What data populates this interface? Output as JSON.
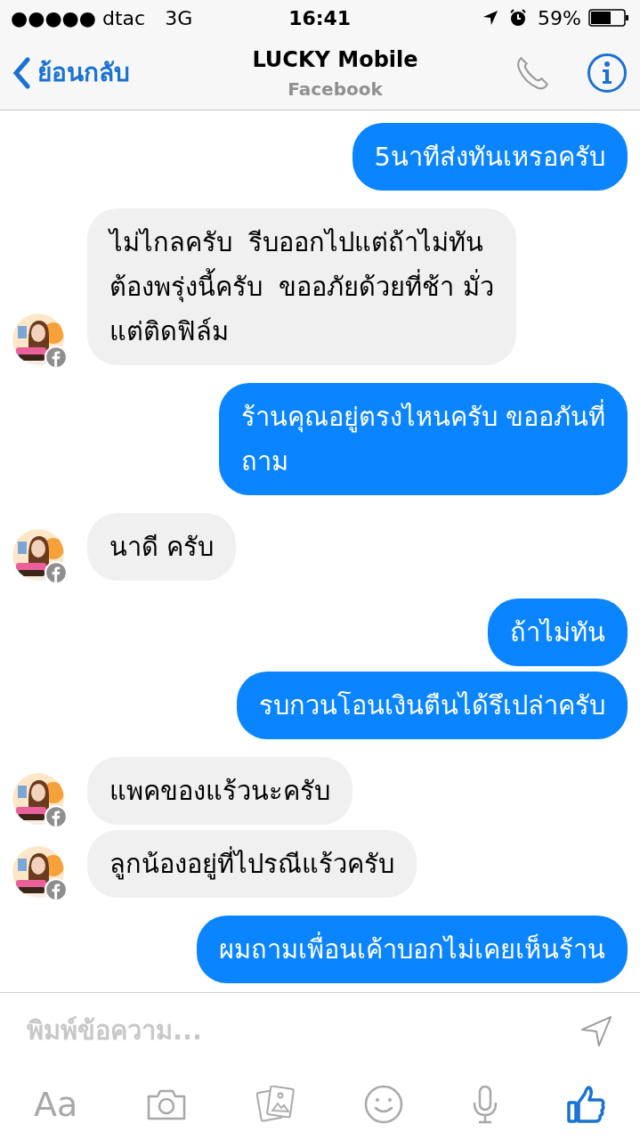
{
  "status_bar": {
    "carrier": "●●●●● dtac",
    "network": "3G",
    "time": "16:41",
    "battery": "59%"
  },
  "header": {
    "back": "ย้อนกลับ",
    "title": "LUCKY Mobile",
    "subtitle": "Facebook"
  },
  "messages": [
    {
      "kind": "sent",
      "text": "5นาทีส่งทันเหรอครับ"
    },
    {
      "kind": "received",
      "text": "ไม่ไกลครับ  รีบออกไปแต่ถ้าไม่ทัน\nต้องพรุ่งนี้ครับ  ขออภัยด้วยที่ช้า มั่ว\nแต่ติดฟิล์ม"
    },
    {
      "kind": "sent",
      "text": "ร้านคุณอยู่ตรงไหนครับ ขออภันที่\nถาม"
    },
    {
      "kind": "received",
      "text": "นาดี ครับ"
    },
    {
      "kind": "sent",
      "text": "ถ้าไม่ทัน"
    },
    {
      "kind": "sent",
      "text": "รบกวนโอนเงินตืนได้รึเปล่าครับ"
    },
    {
      "kind": "received",
      "text": "แพคของแร้วนะครับ"
    },
    {
      "kind": "received",
      "text": "ลูกน้องอยู่ที่ไปรณีแร้วครับ"
    },
    {
      "kind": "sent",
      "text": "ผมถามเพื่อนเค้าบอกไม่เคยเห็นร้าน"
    }
  ],
  "composer": {
    "placeholder": "พิมพ์ข้อความ...",
    "font_button": "Aa"
  }
}
